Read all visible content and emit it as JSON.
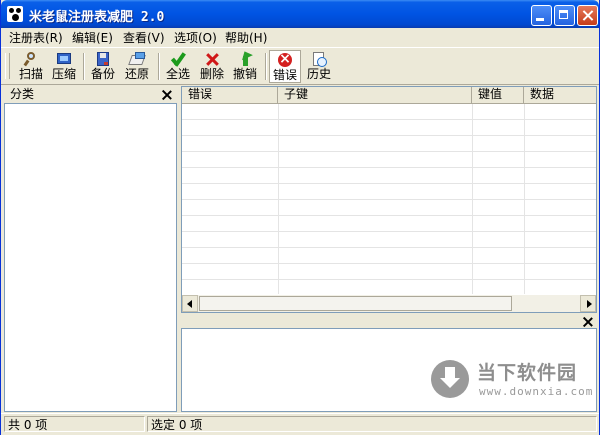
{
  "window": {
    "title": "米老鼠注册表减肥 2.0"
  },
  "menu": [
    {
      "label": "注册表(R)"
    },
    {
      "label": "编辑(E)"
    },
    {
      "label": "查看(V)"
    },
    {
      "label": "选项(O)"
    },
    {
      "label": "帮助(H)"
    }
  ],
  "toolbar": {
    "scan": {
      "label": "扫描",
      "icon": "magnifier-icon"
    },
    "compress": {
      "label": "压缩",
      "icon": "compress-icon"
    },
    "backup": {
      "label": "备份",
      "icon": "floppy-icon"
    },
    "restore": {
      "label": "还原",
      "icon": "restore-icon"
    },
    "select_all": {
      "label": "全选",
      "icon": "checkmark-icon"
    },
    "delete": {
      "label": "删除",
      "icon": "red-x-icon"
    },
    "undo": {
      "label": "撤销",
      "icon": "undo-arrow-icon"
    },
    "errors": {
      "label": "错误",
      "icon": "error-circle-icon",
      "active": true
    },
    "history": {
      "label": "历史",
      "icon": "history-icon"
    }
  },
  "category_pane": {
    "title": "分类"
  },
  "list": {
    "columns": [
      "错误",
      "子键",
      "键值",
      "数据"
    ],
    "rows": []
  },
  "status": {
    "total": "共 0 项",
    "selected": "选定 0 项"
  },
  "watermark": {
    "text": "当下软件园",
    "sub": "www.downxia.com"
  },
  "colors": {
    "titlebar": "#0054e3",
    "window_bg": "#ece9d8",
    "border": "#7f9db9"
  }
}
